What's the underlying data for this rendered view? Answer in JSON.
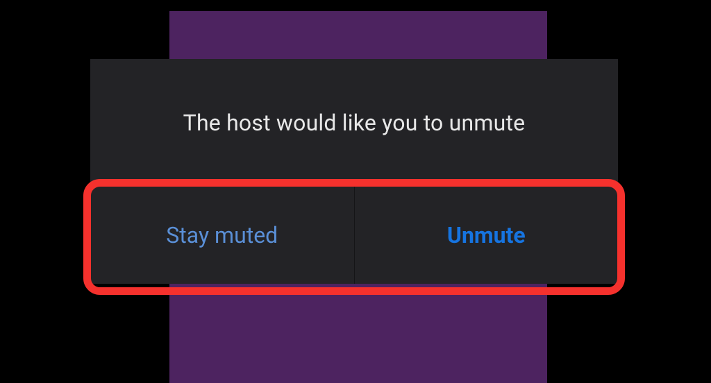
{
  "dialog": {
    "message": "The host would like you to unmute",
    "buttons": {
      "stay_muted": "Stay muted",
      "unmute": "Unmute"
    }
  }
}
